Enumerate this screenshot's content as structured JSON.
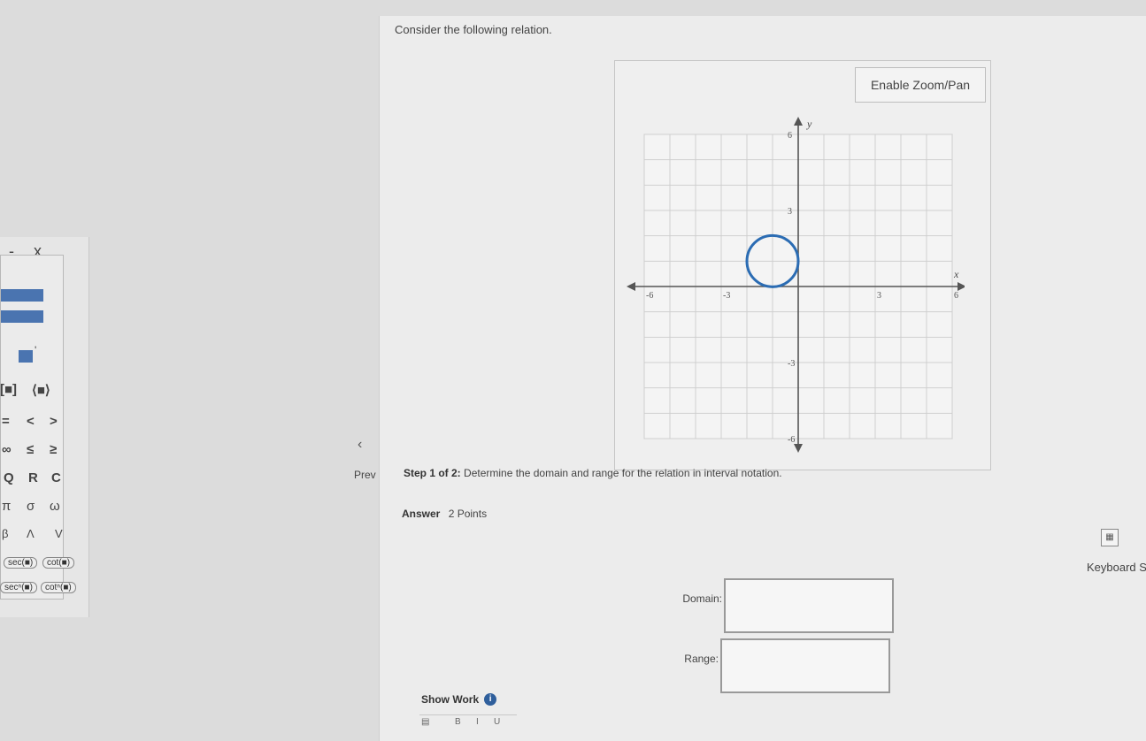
{
  "palette": {
    "minimize_label": "-",
    "close_label": "x",
    "bracket_row": [
      "[■]",
      "⟨■⟩"
    ],
    "compare_row": [
      "=",
      "<",
      ">"
    ],
    "inf_row": [
      "∞",
      "≤",
      "≥"
    ],
    "sets_row": [
      "Q",
      "R",
      "C"
    ],
    "greek_row": [
      "π",
      "σ",
      "ω"
    ],
    "greek_row2": [
      "β",
      "Λ",
      "V"
    ],
    "trig_row1": [
      "sec(■)",
      "cot(■)"
    ],
    "trig_row2": [
      "secⁿ(■)",
      "cotⁿ(■)"
    ]
  },
  "nav": {
    "prev_label": "Prev",
    "prev_icon": "chevron-left-icon"
  },
  "question": {
    "prompt": "Consider the following relation."
  },
  "graph": {
    "zoom_label": "Enable Zoom/Pan",
    "x_axis_label": "x",
    "y_axis_label": "y",
    "x_tick_labels": [
      "-6",
      "-3",
      "3",
      "6"
    ],
    "y_tick_labels": [
      "6",
      "3",
      "-3",
      "-6"
    ],
    "xlim": [
      -6,
      6
    ],
    "ylim": [
      -6,
      6
    ],
    "circle": {
      "center_x": -1,
      "center_y": 1,
      "radius": 1
    }
  },
  "step": {
    "prefix": "Step 1 of 2:",
    "text": "Determine the domain and range for the relation in interval notation."
  },
  "answer": {
    "label": "Answer",
    "points": "2 Points",
    "domain_label": "Domain:",
    "domain_value": "",
    "range_label": "Range:",
    "range_value": ""
  },
  "show_work": {
    "label": "Show Work",
    "icon": "info-icon"
  },
  "keyboard": {
    "label": "Keyboard S",
    "icon": "keyboard-icon"
  }
}
